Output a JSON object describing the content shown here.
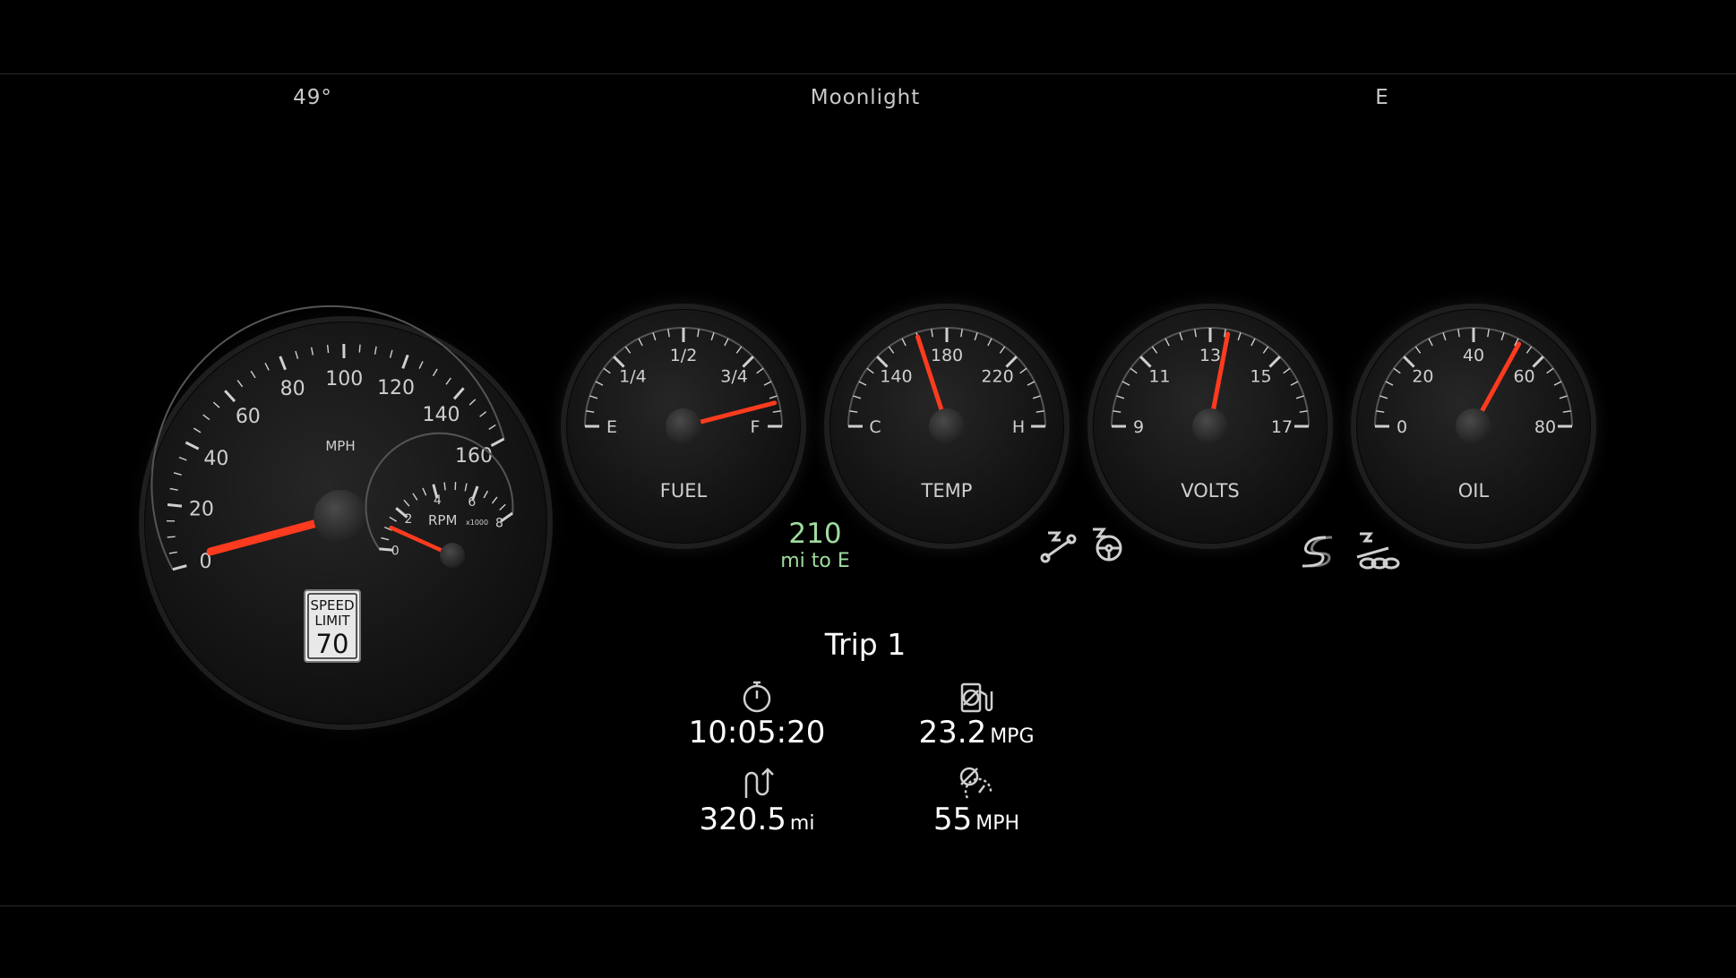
{
  "status_bar": {
    "temperature": "49°",
    "mode": "Moonlight",
    "compass": "E"
  },
  "speedometer": {
    "unit_label": "MPH",
    "ticks": [
      "0",
      "20",
      "40",
      "60",
      "80",
      "100",
      "120",
      "140",
      "160"
    ],
    "speed_mph": 0,
    "max_mph": 170,
    "tach_label": "RPM",
    "tach_unit": "x1000",
    "tach_ticks": [
      "0",
      "2",
      "4",
      "6",
      "8"
    ],
    "rpm_thousands": 1.1,
    "speed_limit_line1": "SPEED",
    "speed_limit_line2": "LIMIT",
    "speed_limit_value": "70"
  },
  "gauges": [
    {
      "name": "fuel",
      "label": "FUEL",
      "ticks": [
        "E",
        "1/4",
        "1/2",
        "3/4",
        "F"
      ],
      "level": 0.92
    },
    {
      "name": "temp",
      "label": "TEMP",
      "ticks": [
        "C",
        "140",
        "180",
        "220",
        "H"
      ],
      "level": 0.4
    },
    {
      "name": "volts",
      "label": "VOLTS",
      "ticks": [
        "9",
        "11",
        "13",
        "15",
        "17"
      ],
      "level": 0.56
    },
    {
      "name": "oil",
      "label": "OIL",
      "ticks": [
        "0",
        "20",
        "40",
        "60",
        "80"
      ],
      "level": 0.66
    }
  ],
  "range": {
    "value": "210",
    "unit": "mi to E"
  },
  "trip": {
    "title": "Trip 1",
    "elapsed_time": "10:05:20",
    "fuel_economy": "23.2",
    "fuel_economy_unit": "MPG",
    "distance": "320.5",
    "distance_unit": "mi",
    "avg_speed": "55",
    "avg_speed_unit": "MPH"
  },
  "colors": {
    "needle": "#ff3b1f",
    "range_text": "#9fdc9f",
    "gauge_face": "#111111",
    "tick": "#cfcfcf"
  }
}
